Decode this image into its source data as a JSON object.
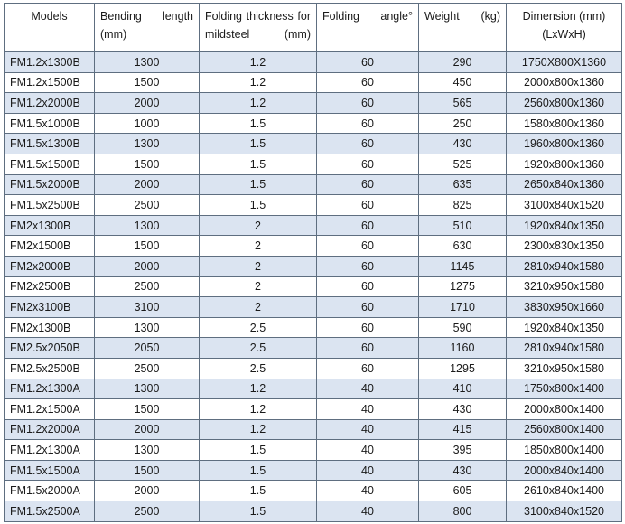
{
  "table": {
    "headers": [
      "Models",
      "Bending length (mm)",
      "Folding thickness for mildsteel (mm)",
      "Folding angle°",
      "Weight (kg)",
      "Dimension (mm) (LxWxH)"
    ],
    "rows": [
      [
        "FM1.2x1300B",
        "1300",
        "1.2",
        "60",
        "290",
        "1750X800X1360"
      ],
      [
        "FM1.2x1500B",
        "1500",
        "1.2",
        "60",
        "450",
        "2000x800x1360"
      ],
      [
        "FM1.2x2000B",
        "2000",
        "1.2",
        "60",
        "565",
        "2560x800x1360"
      ],
      [
        "FM1.5x1000B",
        "1000",
        "1.5",
        "60",
        "250",
        "1580x800x1360"
      ],
      [
        "FM1.5x1300B",
        "1300",
        "1.5",
        "60",
        "430",
        "1960x800x1360"
      ],
      [
        "FM1.5x1500B",
        "1500",
        "1.5",
        "60",
        "525",
        "1920x800x1360"
      ],
      [
        "FM1.5x2000B",
        "2000",
        "1.5",
        "60",
        "635",
        "2650x840x1360"
      ],
      [
        "FM1.5x2500B",
        "2500",
        "1.5",
        "60",
        "825",
        "3100x840x1520"
      ],
      [
        "FM2x1300B",
        "1300",
        "2",
        "60",
        "510",
        "1920x840x1350"
      ],
      [
        "FM2x1500B",
        "1500",
        "2",
        "60",
        "630",
        "2300x830x1350"
      ],
      [
        "FM2x2000B",
        "2000",
        "2",
        "60",
        "1145",
        "2810x940x1580"
      ],
      [
        "FM2x2500B",
        "2500",
        "2",
        "60",
        "1275",
        "3210x950x1580"
      ],
      [
        "FM2x3100B",
        "3100",
        "2",
        "60",
        "1710",
        "3830x950x1660"
      ],
      [
        "FM2x1300B",
        "1300",
        "2.5",
        "60",
        "590",
        "1920x840x1350"
      ],
      [
        "FM2.5x2050B",
        "2050",
        "2.5",
        "60",
        "1160",
        "2810x940x1580"
      ],
      [
        "FM2.5x2500B",
        "2500",
        "2.5",
        "60",
        "1295",
        "3210x950x1580"
      ],
      [
        "FM1.2x1300A",
        "1300",
        "1.2",
        "40",
        "410",
        "1750x800x1400"
      ],
      [
        "FM1.2x1500A",
        "1500",
        "1.2",
        "40",
        "430",
        "2000x800x1400"
      ],
      [
        "FM1.2x2000A",
        "2000",
        "1.2",
        "40",
        "415",
        "2560x800x1400"
      ],
      [
        "FM1.2x1300A",
        "1300",
        "1.5",
        "40",
        "395",
        "1850x800x1400"
      ],
      [
        "FM1.5x1500A",
        "1500",
        "1.5",
        "40",
        "430",
        "2000x840x1400"
      ],
      [
        "FM1.5x2000A",
        "2000",
        "1.5",
        "40",
        "605",
        "2610x840x1400"
      ],
      [
        "FM1.5x2500A",
        "2500",
        "1.5",
        "40",
        "800",
        "3100x840x1520"
      ]
    ]
  }
}
